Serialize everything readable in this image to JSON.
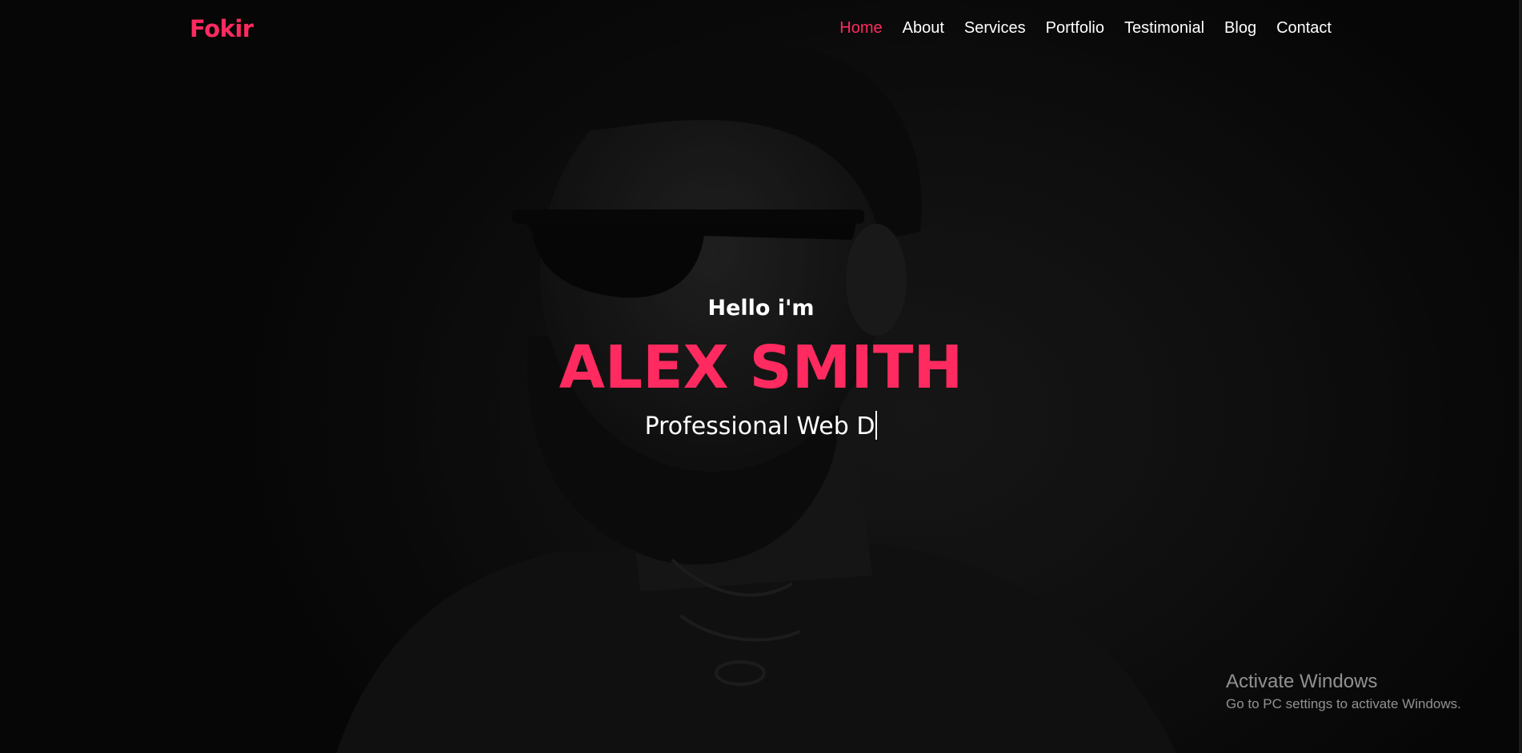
{
  "colors": {
    "accent": "#ff2a5f",
    "background": "#0c0c0c",
    "text": "#ffffff"
  },
  "navbar": {
    "brand": "Fokir",
    "items": [
      {
        "label": "Home",
        "active": true
      },
      {
        "label": "About",
        "active": false
      },
      {
        "label": "Services",
        "active": false
      },
      {
        "label": "Portfolio",
        "active": false
      },
      {
        "label": "Testimonial",
        "active": false
      },
      {
        "label": "Blog",
        "active": false
      },
      {
        "label": "Contact",
        "active": false
      }
    ]
  },
  "hero": {
    "greeting": "Hello i'm",
    "name": "ALEX SMITH",
    "typed_role": "Professional Web D"
  },
  "watermark": {
    "title": "Activate Windows",
    "subtitle": "Go to PC settings to activate Windows."
  }
}
